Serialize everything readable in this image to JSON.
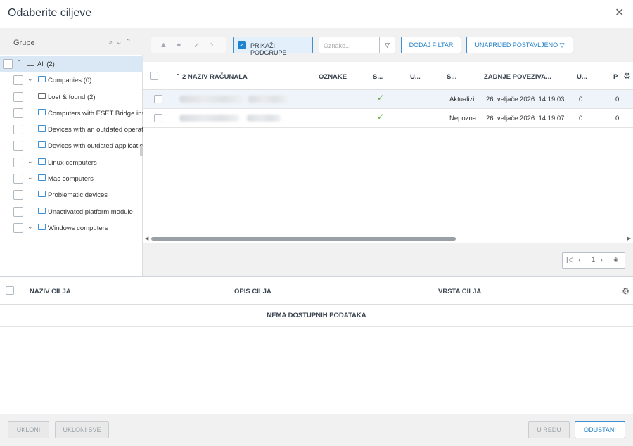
{
  "dialog": {
    "title": "Odaberite ciljeve",
    "close_icon": "close-icon"
  },
  "groups": {
    "header": "Grupe",
    "tree": [
      {
        "label": "All (2)",
        "level": 0,
        "expanded": true,
        "icon": "folder-icon",
        "selected": true
      },
      {
        "label": "Companies (0)",
        "level": 1,
        "expanded": true,
        "icon": "companies-icon"
      },
      {
        "label": "Lost & found (2)",
        "level": 1,
        "expanded": false,
        "icon": "folder-icon"
      },
      {
        "label": "Computers with ESET Bridge inst",
        "level": 1,
        "expanded": false,
        "icon": "dynamic-group-icon"
      },
      {
        "label": "Devices with an outdated operat",
        "level": 1,
        "expanded": false,
        "icon": "dynamic-group-icon"
      },
      {
        "label": "Devices with outdated applicatic",
        "level": 1,
        "expanded": false,
        "icon": "dynamic-group-icon"
      },
      {
        "label": "Linux computers",
        "level": 1,
        "expanded": true,
        "icon": "dynamic-group-icon"
      },
      {
        "label": "Mac computers",
        "level": 1,
        "expanded": true,
        "icon": "dynamic-group-icon"
      },
      {
        "label": "Problematic devices",
        "level": 1,
        "expanded": false,
        "icon": "dynamic-group-icon"
      },
      {
        "label": "Unactivated platform module",
        "level": 1,
        "expanded": false,
        "icon": "dynamic-group-icon"
      },
      {
        "label": "Windows computers",
        "level": 1,
        "expanded": true,
        "icon": "dynamic-group-icon"
      }
    ]
  },
  "toolbar": {
    "show_subgroups": "PRIKAŽI PODGRUPE",
    "tags_placeholder": "Oznake...",
    "add_filter": "DODAJ FILTAR",
    "preset": "UNAPRIJED POSTAVLJENO"
  },
  "computers_table": {
    "columns": [
      "2 NAZIV RAČUNALA",
      "OZNAKE",
      "S...",
      "U...",
      "S...",
      "ZADNJE POVEZIVA...",
      "U...",
      "P"
    ],
    "rows": [
      {
        "status": "Aktualizir",
        "last_connected": "26. veljače 2026. 14:19:03",
        "u": "0",
        "p": "0",
        "ok": true
      },
      {
        "status": "Nepozna",
        "last_connected": "26. veljače 2026. 14:19:07",
        "u": "0",
        "p": "0",
        "ok": true
      }
    ]
  },
  "pager": {
    "page": "1"
  },
  "targets_table": {
    "columns": [
      "NAZIV CILJA",
      "OPIS CILJA",
      "VRSTA CILJA"
    ],
    "empty_text": "NEMA DOSTUPNIH PODATAKA"
  },
  "footer": {
    "remove": "UKLONI",
    "remove_all": "UKLONI SVE",
    "ok": "U REDU",
    "cancel": "ODUSTANI"
  },
  "colors": {
    "accent": "#1f84cf",
    "ok_green": "#5aa832",
    "selected_row": "#d9e8f4"
  }
}
